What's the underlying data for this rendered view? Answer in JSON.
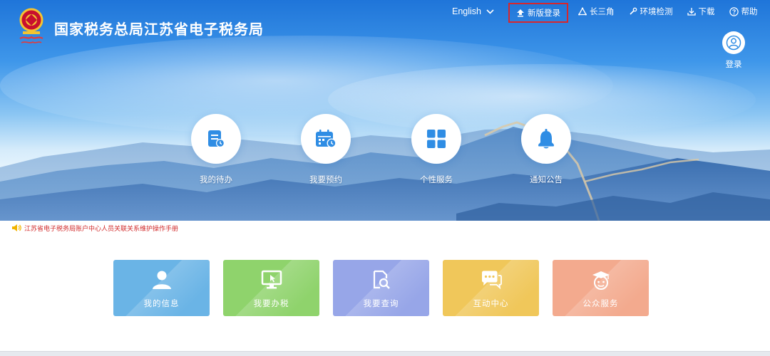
{
  "site": {
    "title": "国家税务总局江苏省电子税务局"
  },
  "topnav": {
    "language": "English",
    "new_login": "新版登录",
    "yangtze": "长三角",
    "env_check": "环境检测",
    "download": "下载",
    "help": "帮助"
  },
  "login": {
    "label": "登录"
  },
  "features": [
    {
      "label": "我的待办",
      "icon": "todo-clock-icon"
    },
    {
      "label": "我要预约",
      "icon": "calendar-clock-icon"
    },
    {
      "label": "个性服务",
      "icon": "grid-icon"
    },
    {
      "label": "通知公告",
      "icon": "bell-icon"
    }
  ],
  "notice": {
    "text": "江苏省电子税务局账户中心人员关联关系维护操作手册",
    "icon": "speaker-icon"
  },
  "tiles": [
    {
      "label": "我的信息",
      "color": "#6ab4e6",
      "icon": "user-icon"
    },
    {
      "label": "我要办税",
      "color": "#8fd36c",
      "icon": "monitor-icon"
    },
    {
      "label": "我要查询",
      "color": "#97a6e8",
      "icon": "doc-search-icon"
    },
    {
      "label": "互动中心",
      "color": "#f0c75a",
      "icon": "chat-icon"
    },
    {
      "label": "公众服务",
      "color": "#f3aa8e",
      "icon": "graduate-icon"
    }
  ],
  "colors": {
    "highlight_border": "#d8262c",
    "feature_icon": "#2f8de4",
    "notice_text": "#d22b2b"
  }
}
